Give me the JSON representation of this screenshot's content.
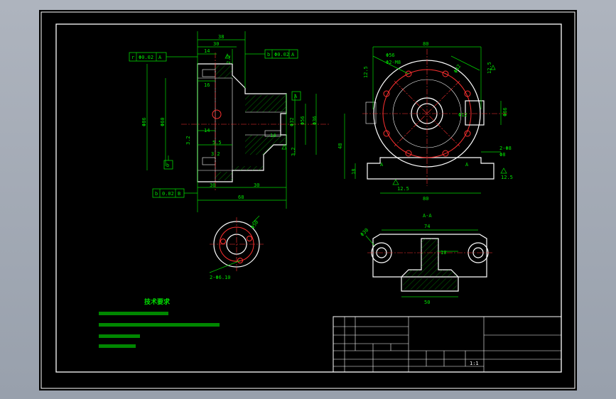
{
  "tech_requirements": {
    "heading": "技术要求"
  },
  "section_label": "A-A",
  "scale": "1:1",
  "dims": {
    "left_view": [
      "38",
      "30",
      "14",
      "16",
      "14",
      "5.5",
      "30",
      "30",
      "68",
      "Φ86",
      "Φ60",
      "Φ32",
      "Φ56",
      "Φ36",
      "2.2",
      "3.2",
      "3.2",
      "14",
      "3.2"
    ],
    "right_view": [
      "80",
      "Φ56",
      "12.5",
      "Φ2-M8",
      "Φ42",
      "12.5",
      "Φ66",
      "Φ12",
      "48",
      "18",
      "A",
      "A",
      "12.5",
      "80",
      "2-Φ8",
      "Φ8",
      "12.5"
    ],
    "flange": [
      "Φ50",
      "2-Φ6.10"
    ],
    "section": [
      "74",
      "10",
      "50",
      "Φ30"
    ]
  },
  "gdt": {
    "top_left": [
      "r",
      "Φ0.02",
      "A"
    ],
    "top_mid": [
      "b",
      "Φ0.02",
      "A"
    ],
    "datum_b": "b",
    "bottom": [
      "b",
      "0.02",
      "B"
    ],
    "datum_a": "A"
  },
  "colors": {
    "background": "#000000",
    "window": "#a4abb6",
    "geometry": "#ffffff",
    "dimension": "#00e000",
    "centerline": "#ff3030"
  }
}
